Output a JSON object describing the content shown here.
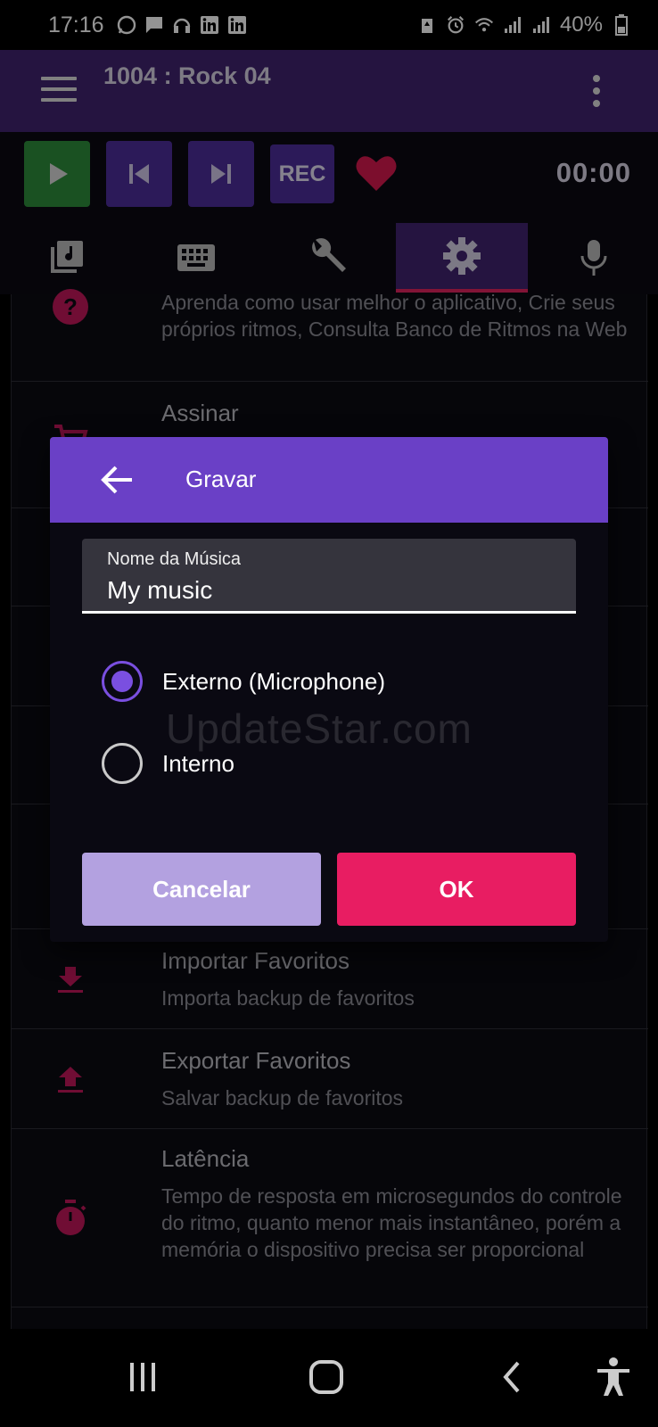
{
  "status_bar": {
    "time": "17:16",
    "left_icons": [
      "whatsapp-icon",
      "message-icon",
      "headset-icon",
      "linkedin-icon",
      "linkedin-icon"
    ],
    "right_icons": [
      "recycle-icon",
      "alarm-icon",
      "wifi-icon",
      "signal-icon",
      "signal-icon",
      "battery-icon"
    ],
    "battery": "40%"
  },
  "app_bar": {
    "title": "1004 : Rock 04"
  },
  "controls": {
    "rec_label": "REC",
    "timer": "00:00"
  },
  "tabs": [
    {
      "name": "music-library-icon",
      "active": false
    },
    {
      "name": "keyboard-icon",
      "active": false
    },
    {
      "name": "wrench-icon",
      "active": false
    },
    {
      "name": "settings-icon",
      "active": true
    },
    {
      "name": "microphone-icon",
      "active": false
    }
  ],
  "list": {
    "help_subtitle": "Aprenda como usar melhor o aplicativo, Crie seus próprios ritmos, Consulta Banco de Ritmos na Web",
    "subscribe_title": "Assinar",
    "import_title": "Importar Favoritos",
    "import_subtitle": "Importa backup de favoritos",
    "export_title": "Exportar Favoritos",
    "export_subtitle": "Salvar backup de favoritos",
    "latency_title": "Latência",
    "latency_subtitle": "Tempo de resposta em microsegundos do controle do ritmo, quanto menor mais instantâneo, porém a memória o dispositivo precisa ser proporcional"
  },
  "dialog": {
    "title": "Gravar",
    "field_label": "Nome da Música",
    "field_value": "My music",
    "option_external": "Externo (Microphone)",
    "option_internal": "Interno",
    "selected": "external",
    "cancel_label": "Cancelar",
    "ok_label": "OK"
  },
  "watermark": "UpdateStar.com",
  "colors": {
    "app_bar": "#41246f",
    "dialog_header": "#6a40c6",
    "accent_pink": "#e81d62",
    "play_green": "#2e8c3c",
    "control_purple": "#4d2e99",
    "icon_red": "#c2185b"
  }
}
